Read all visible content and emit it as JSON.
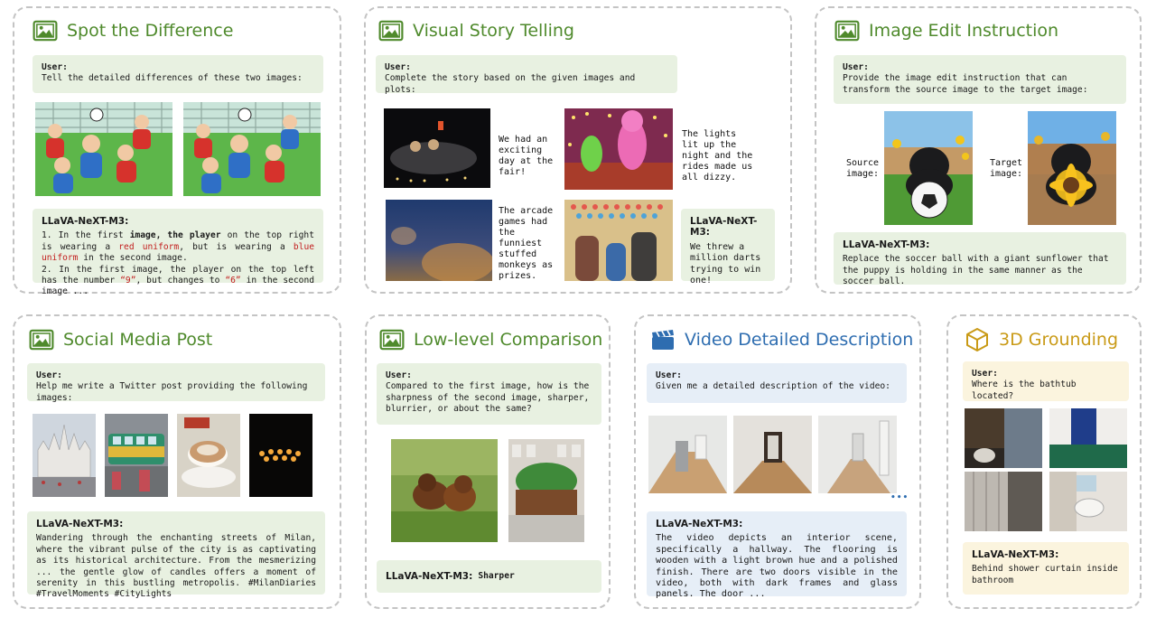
{
  "colors": {
    "green": "#4f8a2c",
    "blue": "#2e6db0",
    "gold": "#c99a16",
    "green_box": "#e8f1e1",
    "blue_box": "#e6eef7",
    "yellow_box": "#fbf4de",
    "red_text": "#c21d1d"
  },
  "icons": {
    "image": "image-icon",
    "video": "clapperboard-icon",
    "cube": "cube-icon"
  },
  "spot": {
    "title": "Spot the Difference",
    "user_label": "User:",
    "user_text": "Tell the detailed differences of these two images:",
    "resp_label": "LLaVA-NeXT-M3:",
    "r1": "1. In the first ",
    "r2": "image, the player",
    "r3": " on the top right is wearing a ",
    "r4": "red uniform",
    "r5": ", but is wearing a ",
    "r6": "blue uniform",
    "r7": " in the second image.",
    "r8": "2. In the first image, the player on the top left has the number ",
    "r9": "“9”",
    "r10": ", but changes to ",
    "r11": "“6”",
    "r12": " in the second image ..."
  },
  "story": {
    "title": "Visual Story Telling",
    "user_label": "User:",
    "user_text": "Complete the story based on the given images and plots:",
    "cap1": "We had an exciting day at the fair!",
    "cap2": "The lights lit up the night and the rides made us all dizzy.",
    "cap3": "The arcade games had the funniest stuffed monkeys as prizes.",
    "resp_label": "LLaVA-NeXT-M3:",
    "resp_text": "We threw a million darts trying to win one!"
  },
  "edit": {
    "title": "Image Edit Instruction",
    "user_label": "User:",
    "user_text": "Provide the image edit instruction that can transform the source image to the target image:",
    "source_label": "Source image:",
    "target_label": "Target image:",
    "resp_label": "LLaVA-NeXT-M3:",
    "resp_text": "Replace the soccer ball with a giant sunflower that the puppy is holding in the same manner as the soccer ball."
  },
  "social": {
    "title": "Social Media Post",
    "user_label": "User:",
    "user_text": "Help me write a Twitter post providing the following images:",
    "resp_label": "LLaVA-NeXT-M3:",
    "resp_text": "Wandering through the enchanting streets of Milan, where the vibrant pulse of the city is as captivating as its historical architecture. From the mesmerizing ... the gentle glow of candles offers a moment of serenity in this bustling metropolis. #MilanDiaries #TravelMoments #CityLights"
  },
  "lowlevel": {
    "title": "Low-level Comparison",
    "user_label": "User:",
    "user_text": "Compared to the first image, how is the sharpness of the second image, sharper, blurrier, or about the same?",
    "resp_label": "LLaVA-NeXT-M3:",
    "resp_text": "Sharper"
  },
  "video": {
    "title": "Video Detailed Description",
    "user_label": "User:",
    "user_text": "Given me a detailed description of the video:",
    "dots": "•••",
    "resp_label": "LLaVA-NeXT-M3:",
    "resp_text": "The video depicts an interior scene, specifically a hallway. The flooring is wooden with a light brown hue and a polished finish. There are two doors visible in the video, both with dark frames and glass panels. The door ..."
  },
  "grounding": {
    "title": "3D Grounding",
    "user_label": "User:",
    "user_text": "Where is the bathtub located?",
    "resp_label": "LLaVA-NeXT-M3:",
    "resp_text": "Behind shower curtain inside bathroom"
  }
}
